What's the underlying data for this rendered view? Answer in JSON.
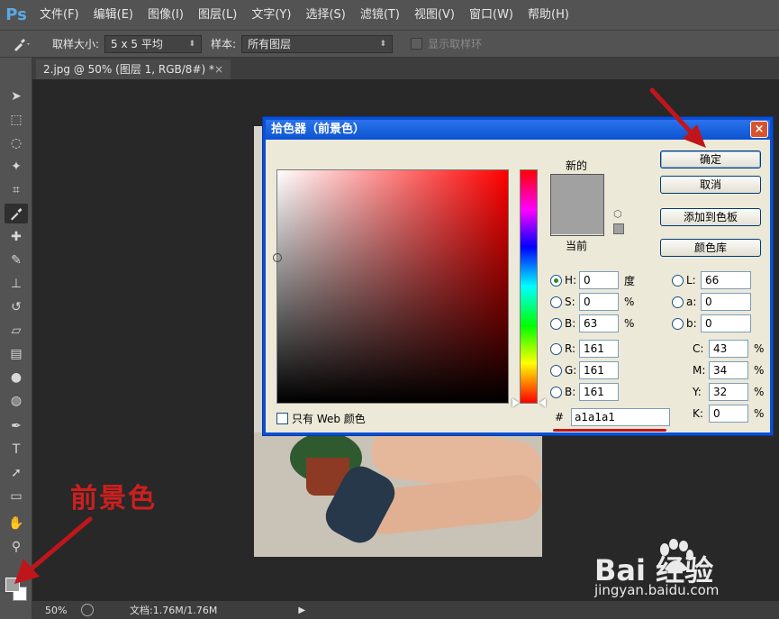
{
  "app": {
    "logo": "Ps",
    "menus": [
      "文件(F)",
      "编辑(E)",
      "图像(I)",
      "图层(L)",
      "文字(Y)",
      "选择(S)",
      "滤镜(T)",
      "视图(V)",
      "窗口(W)",
      "帮助(H)"
    ]
  },
  "options": {
    "sample_size_label": "取样大小:",
    "sample_size_value": "5 x 5 平均",
    "sample_label": "样本:",
    "sample_value": "所有图层",
    "show_ring_label": "显示取样环"
  },
  "document": {
    "tab_title": "2.jpg @ 50% (图层 1, RGB/8#) *",
    "tab_close": "×"
  },
  "status": {
    "zoom": "50%",
    "doc_size": "文档:1.76M/1.76M"
  },
  "annotation": {
    "label": "前景色",
    "color": "#cc1f1f"
  },
  "watermark": {
    "main": "Bai 经验",
    "sub": "jingyan.baidu.com"
  },
  "dialog": {
    "title": "拾色器（前景色）",
    "close": "×",
    "new_label": "新的",
    "current_label": "当前",
    "new_color": "#a1a1a1",
    "current_color": "#a1a1a1",
    "web_only_label": "只有 Web 颜色",
    "buttons": {
      "ok": "确定",
      "cancel": "取消",
      "add_swatch": "添加到色板",
      "color_library": "颜色库"
    },
    "fields": {
      "h": {
        "label": "H:",
        "value": "0",
        "unit": "度"
      },
      "s": {
        "label": "S:",
        "value": "0",
        "unit": "%"
      },
      "b": {
        "label": "B:",
        "value": "63",
        "unit": "%"
      },
      "r": {
        "label": "R:",
        "value": "161"
      },
      "g": {
        "label": "G:",
        "value": "161"
      },
      "bl": {
        "label": "B:",
        "value": "161"
      },
      "l": {
        "label": "L:",
        "value": "66"
      },
      "a": {
        "label": "a:",
        "value": "0"
      },
      "b_lab": {
        "label": "b:",
        "value": "0"
      },
      "c": {
        "label": "C:",
        "value": "43",
        "unit": "%"
      },
      "m": {
        "label": "M:",
        "value": "34",
        "unit": "%"
      },
      "y": {
        "label": "Y:",
        "value": "32",
        "unit": "%"
      },
      "k": {
        "label": "K:",
        "value": "0",
        "unit": "%"
      }
    },
    "hex_label": "#",
    "hex_value": "a1a1a1"
  }
}
